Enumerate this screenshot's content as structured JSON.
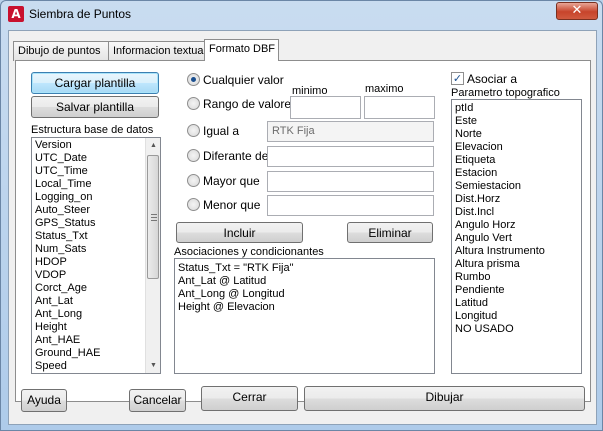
{
  "window": {
    "title": "Siembra de Puntos",
    "icon": "autocad-a-icon",
    "icon_glyph": "A",
    "close_glyph": "✕"
  },
  "tabs": [
    {
      "label": "Dibujo de puntos"
    },
    {
      "label": "Informacion textual"
    },
    {
      "label": "Formato DBF"
    }
  ],
  "left": {
    "load_button": "Cargar plantilla",
    "save_button": "Salvar plantilla",
    "db_structure_label": "Estructura base de datos",
    "db_fields": [
      "Version",
      "UTC_Date",
      "UTC_Time",
      "Local_Time",
      "Logging_on",
      "Auto_Steer",
      "GPS_Status",
      "Status_Txt",
      "Num_Sats",
      "HDOP",
      "VDOP",
      "Corct_Age",
      "Ant_Lat",
      "Ant_Long",
      "Height",
      "Ant_HAE",
      "Ground_HAE",
      "Speed"
    ]
  },
  "conditions": {
    "any_value_label": "Cualquier valor",
    "range_label": "Rango de valores",
    "min_label": "minimo",
    "max_label": "maximo",
    "min_value": "",
    "max_value": "",
    "equal_label": "Igual a",
    "equal_value": "RTK Fija",
    "not_equal_label": "Diferante de",
    "not_equal_value": "",
    "greater_label": "Mayor que",
    "greater_value": "",
    "less_label": "Menor que",
    "less_value": "",
    "selected": "any_value"
  },
  "middle": {
    "include_button": "Incluir",
    "delete_button": "Eliminar",
    "associations_label": "Asociaciones y condicionantes",
    "associations": [
      "Status_Txt  = \"RTK Fija\"",
      "Ant_Lat  @  Latitud",
      "Ant_Long  @  Longitud",
      "Height  @  Elevacion"
    ]
  },
  "right": {
    "associate_label": "Asociar a",
    "associate_checked": true,
    "checkmark": "✓",
    "param_label": "Parametro topografico",
    "params": [
      "ptId",
      "Este",
      "Norte",
      "Elevacion",
      "Etiqueta",
      "Estacion",
      "Semiestacion",
      "Dist.Horz",
      "Dist.Incl",
      "Angulo Horz",
      "Angulo Vert",
      "Altura Instrumento",
      "Altura prisma",
      "Rumbo",
      "Pendiente",
      "Latitud",
      "Longitud",
      "NO USADO"
    ]
  },
  "footer": {
    "help_button": "Ayuda",
    "cancel_button": "Cancelar",
    "close_button": "Cerrar",
    "draw_button": "Dibujar"
  }
}
